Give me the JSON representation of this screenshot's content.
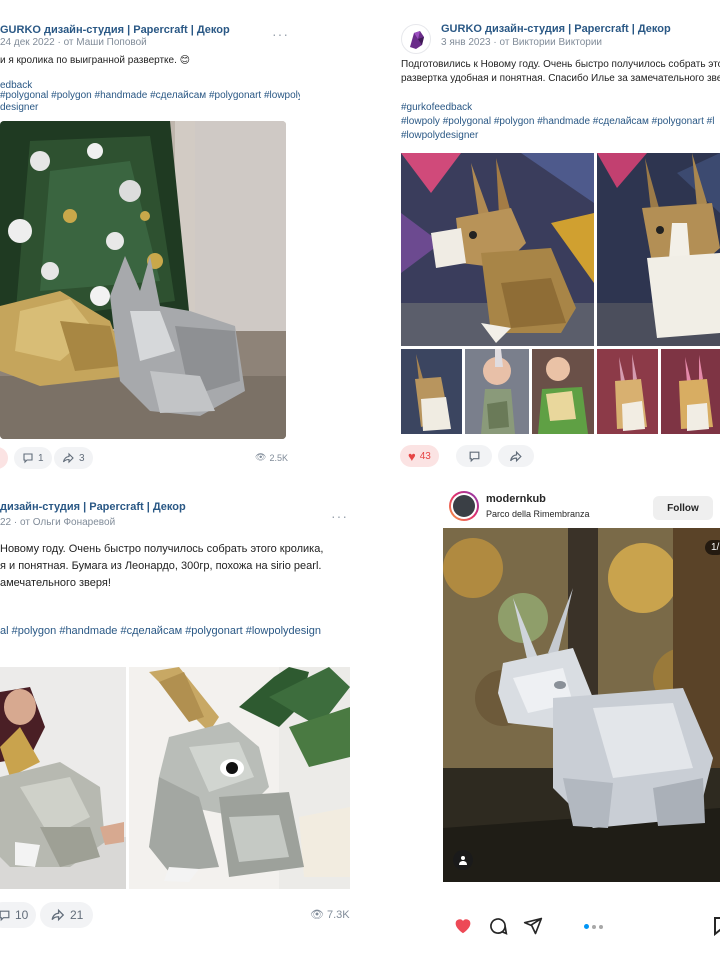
{
  "post1": {
    "title": "GURKO дизайн-студия | Papercraft | Декор",
    "date": "24 дек 2022",
    "author": "· от Маши Поповой",
    "text_line1": "и я кролика по выигранной развертке. 😊",
    "tag_line1": "edback",
    "tag_line2": "#polygonal #polygon #handmade #сделайсам #polygonart #lowpolydesign",
    "tag_line3": "designer",
    "comments": "1",
    "shares": "3",
    "views": "2.5K"
  },
  "post2": {
    "title": "GURKO дизайн-студия | Papercraft | Декор",
    "date": "3 янв 2023",
    "author": "· от Виктории Виктории",
    "text_line1": "Подготовились к Новому году. Очень быстро получилось собрать этого к",
    "text_line2": "развертка удобная и понятная. Спасибо Илье за замечательного зве",
    "tag_line1": "#gurkofeedback",
    "tag_line2": "#lowpoly #polygonal #polygon #handmade #сделайсам #polygonart #l",
    "tag_line3": "#lowpolydesigner",
    "likes": "43"
  },
  "post3": {
    "title": "дизайн-студия | Papercraft | Декор",
    "date": "22",
    "author": "· от Ольги Фонаревой",
    "text_line1": "Новому году. Очень быстро получилось собрать этого кролика,",
    "text_line2": "я и понятная. Бумага из Леонардо, 300гр, похожа на sirio pearl.",
    "text_line3": "амечательного зверя!",
    "tag_line1": "al #polygon #handmade #сделайсам #polygonart #lowpolydesign",
    "comments": "10",
    "shares": "21",
    "views": "7.3K"
  },
  "post4": {
    "username": "modernkub",
    "location": "Parco della Rimembranza",
    "follow": "Follow",
    "counter": "1/"
  },
  "colors": {
    "accent_red": "#e64646",
    "link_blue": "#2a5885",
    "muted": "#818c99"
  }
}
